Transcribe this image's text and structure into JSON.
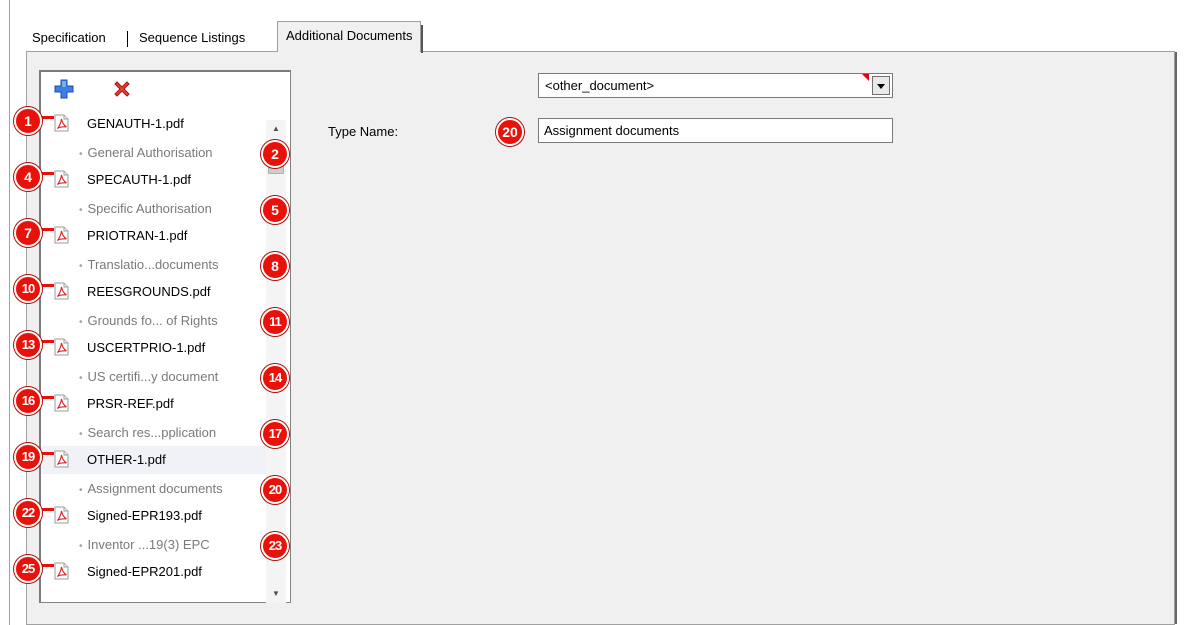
{
  "tabs": [
    {
      "label": "Specification"
    },
    {
      "label": "Sequence Listings"
    },
    {
      "label": "Additional Documents"
    }
  ],
  "toolbar": {
    "add_icon": "plus-icon",
    "delete_icon": "x-icon",
    "add_color": "#2b6fe0",
    "delete_color": "#e3282b"
  },
  "documents": [
    {
      "file": "GENAUTH-1.pdf",
      "desc": "General Authorisation",
      "file_badge": "1",
      "desc_badge": "2"
    },
    {
      "file": "SPECAUTH-1.pdf",
      "desc": "Specific Authorisation",
      "file_badge": "4",
      "desc_badge": "5"
    },
    {
      "file": "PRIOTRAN-1.pdf",
      "desc": "Translatio...documents",
      "file_badge": "7",
      "desc_badge": "8"
    },
    {
      "file": "REESGROUNDS.pdf",
      "desc": "Grounds fo... of Rights",
      "file_badge": "10",
      "desc_badge": "11"
    },
    {
      "file": "USCERTPRIO-1.pdf",
      "desc": "US certifi...y document",
      "file_badge": "13",
      "desc_badge": "14"
    },
    {
      "file": "PRSR-REF.pdf",
      "desc": "Search res...pplication",
      "file_badge": "16",
      "desc_badge": "17"
    },
    {
      "file": "OTHER-1.pdf",
      "desc": "Assignment documents",
      "file_badge": "19",
      "desc_badge": "20"
    },
    {
      "file": "Signed-EPR193.pdf",
      "desc": "Inventor ...19(3) EPC",
      "file_badge": "22",
      "desc_badge": "23"
    },
    {
      "file": "Signed-EPR201.pdf",
      "desc": "",
      "file_badge": "25",
      "desc_badge": ""
    }
  ],
  "selected_index": 6,
  "document_type": {
    "value": "<other_document>"
  },
  "type_name": {
    "label": "Type Name:",
    "value": "Assignment documents",
    "badge": "20"
  },
  "colors": {
    "badge": "#e8120b",
    "panel": "#f0f0f0",
    "pdf_red": "#d9222a"
  }
}
